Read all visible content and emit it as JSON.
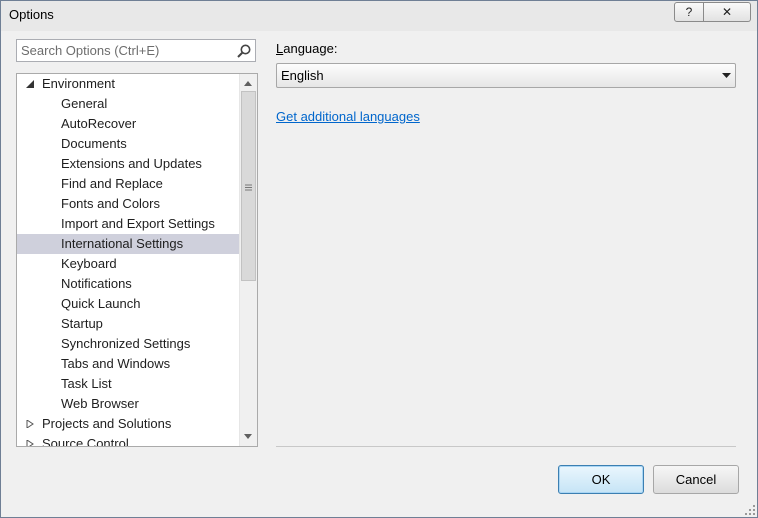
{
  "window": {
    "title": "Options",
    "help_label": "?",
    "close_label": "✕"
  },
  "search": {
    "placeholder": "Search Options (Ctrl+E)",
    "icon": "search-icon"
  },
  "tree": {
    "items": [
      {
        "label": "Environment",
        "level": 0,
        "expander": "expanded"
      },
      {
        "label": "General",
        "level": 1
      },
      {
        "label": "AutoRecover",
        "level": 1
      },
      {
        "label": "Documents",
        "level": 1
      },
      {
        "label": "Extensions and Updates",
        "level": 1
      },
      {
        "label": "Find and Replace",
        "level": 1
      },
      {
        "label": "Fonts and Colors",
        "level": 1
      },
      {
        "label": "Import and Export Settings",
        "level": 1
      },
      {
        "label": "International Settings",
        "level": 1,
        "selected": true
      },
      {
        "label": "Keyboard",
        "level": 1
      },
      {
        "label": "Notifications",
        "level": 1
      },
      {
        "label": "Quick Launch",
        "level": 1
      },
      {
        "label": "Startup",
        "level": 1
      },
      {
        "label": "Synchronized Settings",
        "level": 1
      },
      {
        "label": "Tabs and Windows",
        "level": 1
      },
      {
        "label": "Task List",
        "level": 1
      },
      {
        "label": "Web Browser",
        "level": 1
      },
      {
        "label": "Projects and Solutions",
        "level": 0,
        "expander": "collapsed"
      },
      {
        "label": "Source Control",
        "level": 0,
        "expander": "collapsed"
      }
    ]
  },
  "language": {
    "label_accel": "L",
    "label_rest": "anguage:",
    "selected": "English",
    "link": "Get additional languages"
  },
  "buttons": {
    "ok": "OK",
    "cancel": "Cancel"
  },
  "colors": {
    "selection": "#cfd0dc",
    "link": "#0066cc",
    "default_button_border": "#3c7fb1"
  }
}
